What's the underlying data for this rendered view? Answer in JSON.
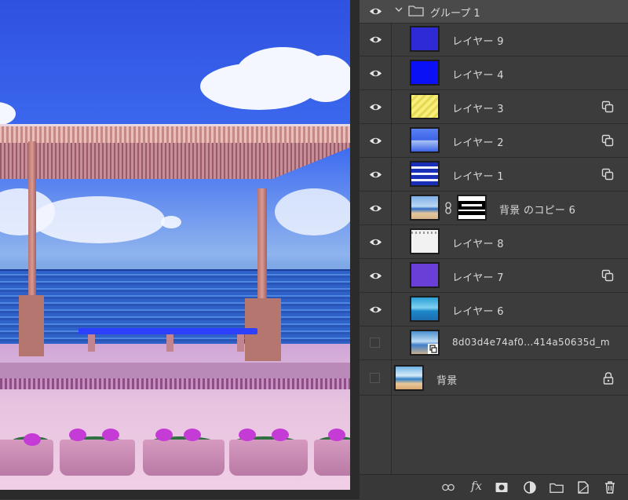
{
  "canvas": {
    "description_icon": "photo-canvas"
  },
  "layers_panel": {
    "group": {
      "name": "グループ 1",
      "expanded": true,
      "visible": true
    },
    "layers": [
      {
        "name": "レイヤー 9",
        "visible": true,
        "thumb_color": "#2d2ad6",
        "clipping": false
      },
      {
        "name": "レイヤー 4",
        "visible": true,
        "thumb_color": "#0a12f5",
        "clipping": false
      },
      {
        "name": "レイヤー 3",
        "visible": true,
        "thumb_color": "#f4ec72",
        "clipping": true
      },
      {
        "name": "レイヤー 2",
        "visible": true,
        "thumb_color": "#3d63e8",
        "clipping": true
      },
      {
        "name": "レイヤー 1",
        "visible": true,
        "thumb_color": "#1a2fb8",
        "clipping": true
      },
      {
        "name": "背景 のコピー 6",
        "visible": true,
        "thumb_color": "#7fb1e8",
        "has_mask": true,
        "clipping": false
      },
      {
        "name": "レイヤー 8",
        "visible": true,
        "thumb_color": "#f2f2f2",
        "clipping": false
      },
      {
        "name": "レイヤー 7",
        "visible": true,
        "thumb_color": "#6a3fd8",
        "clipping": true
      },
      {
        "name": "レイヤー 6",
        "visible": true,
        "thumb_color": "#2a9ed6",
        "clipping": false
      },
      {
        "name": "8d03d4e74af0...414a50635d_m",
        "visible": false,
        "thumb_color": "#4a8fd0",
        "smart_object": true,
        "clipping": false
      }
    ],
    "background_layer": {
      "name": "背景",
      "visible": false,
      "locked": true,
      "thumb_color": "#6fb4e6"
    },
    "footer_icons": [
      "link-layers-icon",
      "fx-icon",
      "add-mask-icon",
      "adjustment-layer-icon",
      "new-group-icon",
      "new-layer-icon",
      "delete-icon"
    ],
    "fx_label": "fx"
  }
}
